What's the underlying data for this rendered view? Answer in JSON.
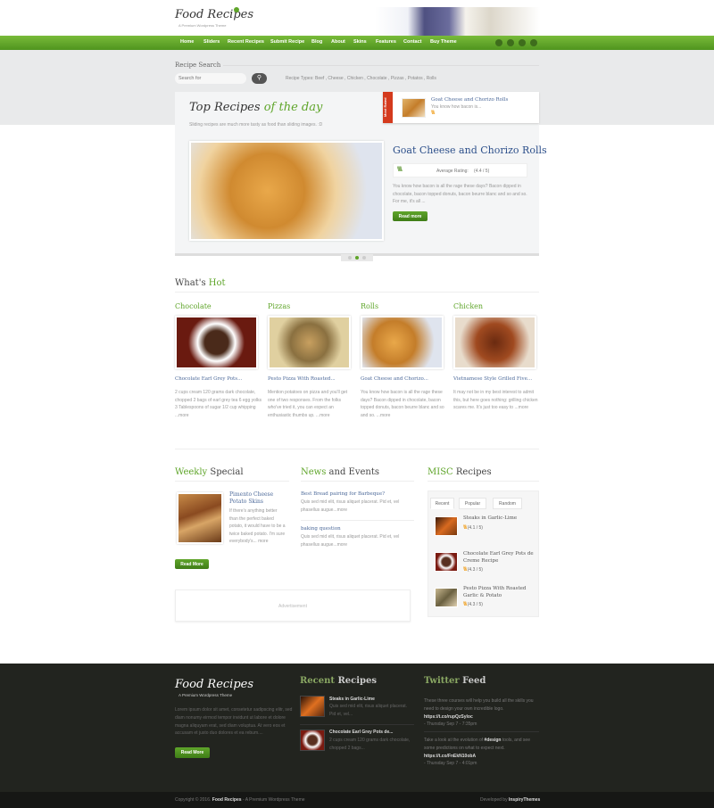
{
  "brand": {
    "name": "Food Recipes",
    "tagline": "A Premium Wordpress Theme",
    "accent": "#5fa52a"
  },
  "nav": {
    "items": [
      "Home",
      "Sliders",
      "Recent Recipes",
      "Submit Recipe",
      "Blog",
      "About",
      "Skins",
      "Features",
      "Contact",
      "Buy Theme"
    ],
    "social": [
      "facebook-icon",
      "twitter-icon",
      "rss-icon",
      "email-icon"
    ]
  },
  "search": {
    "title": "Recipe Search",
    "placeholder": "Search for",
    "button_icon": "search-icon",
    "types_label": "Recipe Types: Beef , Cheese , Chicken , Chocolate , Pizzas , Potatos , Rolls"
  },
  "slider": {
    "title_a": "Top Recipes",
    "title_b": "of the day",
    "subtitle": "Sliding recipes are much more tasty as food than sliding images. :D",
    "most_rated": {
      "badge": "Most Rated",
      "title": "Goat Cheese and Chorizo Rolls",
      "text": "You know how bacon is...",
      "stars": "\\\\\\\\\\"
    },
    "slide": {
      "title": "Goat Cheese and Chorizo Rolls",
      "rating_label": "Average Rating:",
      "rating": "(4.4 / 5)",
      "stars": "\\\\\\\\\\",
      "text": "You know how bacon is all the rage these days? Bacon dipped in chocolate, bacon topped donuts, bacon beurre blanc and so and so. For me, it's all ...",
      "button": "Read more"
    },
    "active_slide": 2,
    "slide_count": 3
  },
  "whats_hot": {
    "title_a": "What's",
    "title_b": "Hot",
    "items": [
      {
        "category": "Chocolate",
        "title": "Chocolate Earl Grey Pots...",
        "text": "2 cups cream 120 grams dark chocolate, chopped 2 bags of earl grey tea 6 egg yolks 3 Tablespoons of sugar 1/2 cup whipping ...more"
      },
      {
        "category": "Pizzas",
        "title": "Pesto Pizza With Roasted...",
        "text": "Mention potatoes on pizza and you'll get one of two responses. From the folks who've tried it, you can expect an enthusiastic thumbs up. ...more"
      },
      {
        "category": "Rolls",
        "title": "Goat Cheese and Chorizo...",
        "text": "You know how bacon is all the rage these days? Bacon dipped in chocolate, bacon topped donuts, bacon beurre blanc and so and so. ...more"
      },
      {
        "category": "Chicken",
        "title": "Vietnamese Style Grilled Five...",
        "text": "It may not be in my best interest to admit this, but here goes nothing: grilling chicken scares me. It's just too easy to ...more"
      }
    ]
  },
  "weekly": {
    "title_a": "Weekly",
    "title_b": "Special",
    "item_title": "Pimento Cheese Potato Skins",
    "text": "If there's anything better than the perfect baked potato, it would have to be a twice baked potato. I'm sure everybody's... more",
    "button": "Read More"
  },
  "news": {
    "title_a": "News",
    "title_b": "and Events",
    "items": [
      {
        "title": "Best Bread pairing for Barbeque?",
        "text": "Quis sed mid elit, risus aliquet placerat. Pid et, vel phasellus augue...more"
      },
      {
        "title": "baking question",
        "text": "Quis sed mid elit, risus aliquet placerat. Pid et, vel phasellus augue...more"
      }
    ]
  },
  "ad": {
    "label": "Advertisement"
  },
  "misc": {
    "title_a": "MISC",
    "title_b": "Recipes",
    "tabs": [
      "Recent",
      "Popular",
      "Random"
    ],
    "active_tab": "Recent",
    "items": [
      {
        "title": "Steaks in Garlic-Lime",
        "rating": "(4.1 / 5)"
      },
      {
        "title": "Chocolate Earl Grey Pots de Creme Recipe",
        "rating": "(4.3 / 5)"
      },
      {
        "title": "Pesto Pizza With Roasted Garlic & Potato",
        "rating": "(4.3 / 5)"
      }
    ],
    "stars": "\\\\\\\\\\"
  },
  "footer": {
    "text": "Lorem ipsum dolor sit amet, consetetur sadipscing elitr, sed diam nonumy eirmod tempor invidunt ut labore et dolore magna aliquyam erat, sed diam voluptua. At vero eos et accusam et justo duo dolores et ea rebum....",
    "button": "Read More",
    "recent_title_a": "Recent",
    "recent_title_b": "Recipes",
    "recent": [
      {
        "title": "Steaks in Garlic-Lime",
        "text": "Quis sed mid elit, risus aliquet placerat. Pid et, vel..."
      },
      {
        "title": "Chocolate Earl Grey Pots de...",
        "text": "2 cups cream 120 grams dark chocolate, chopped 2 bags..."
      }
    ],
    "twitter_title_a": "Twitter",
    "twitter_title_b": "Feed",
    "tweets": [
      {
        "text": "These three courses will help you build all the skills you need to design your own incredible logo.",
        "link": "https://t.co/rupQzSyloc",
        "date": "- Thursday Sep 7 - 7:35pm"
      },
      {
        "pre": "Take a look at the evolution of",
        "tag": "#design",
        "post": "tools, and see some predictions on what to expect next.",
        "link": "https://t.co/FnEkN10obA",
        "date": "- Thursday Sep 7 - 4:01pm"
      }
    ],
    "copyright_pre": "Copyright © 2016.",
    "copyright_brand": "Food Recipes",
    "copyright_post": "- A Premium Wordpress Theme",
    "dev_pre": "Developed by",
    "dev_name": "InspiryThemes"
  }
}
